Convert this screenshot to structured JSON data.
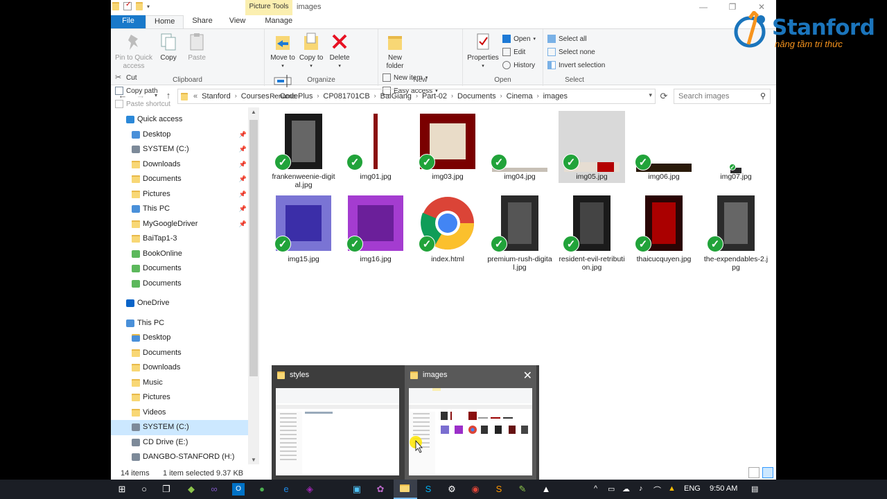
{
  "window": {
    "title": "images",
    "context_tab": "Picture Tools",
    "minimize": "—",
    "maximize": "❐",
    "close": "✕"
  },
  "tabs": [
    {
      "label": "File"
    },
    {
      "label": "Home"
    },
    {
      "label": "Share"
    },
    {
      "label": "View"
    },
    {
      "label": "Manage"
    }
  ],
  "ribbon": {
    "clipboard": {
      "label": "Clipboard",
      "pin": "Pin to Quick access",
      "copy": "Copy",
      "paste": "Paste",
      "cut": "Cut",
      "copy_path": "Copy path",
      "paste_shortcut": "Paste shortcut"
    },
    "organize": {
      "label": "Organize",
      "move_to": "Move to",
      "copy_to": "Copy to",
      "delete": "Delete",
      "rename": "Rename"
    },
    "new": {
      "label": "New",
      "new_folder": "New folder",
      "new_item": "New item",
      "easy_access": "Easy access"
    },
    "open": {
      "label": "Open",
      "properties": "Properties",
      "open": "Open",
      "edit": "Edit",
      "history": "History"
    },
    "select": {
      "label": "Select",
      "select_all": "Select all",
      "select_none": "Select none",
      "invert": "Invert selection"
    }
  },
  "address": {
    "segments": [
      "Stanford",
      "Courses",
      "CodePlus",
      "CP081701CB",
      "BaiGiang",
      "Part-02",
      "Documents",
      "Cinema",
      "images"
    ],
    "prefix": "«",
    "search_placeholder": "Search images"
  },
  "nav_pane": {
    "quick_access": "Quick access",
    "quick_items": [
      {
        "label": "Desktop",
        "pinned": true
      },
      {
        "label": "SYSTEM (C:)",
        "pinned": true
      },
      {
        "label": "Downloads",
        "pinned": true
      },
      {
        "label": "Documents",
        "pinned": true
      },
      {
        "label": "Pictures",
        "pinned": true
      },
      {
        "label": "This PC",
        "pinned": true
      },
      {
        "label": "MyGoogleDriver",
        "pinned": true
      },
      {
        "label": "BaiTap1-3",
        "pinned": false
      },
      {
        "label": "BookOnline",
        "pinned": false
      },
      {
        "label": "Documents",
        "pinned": false
      },
      {
        "label": "Documents",
        "pinned": false
      }
    ],
    "onedrive": "OneDrive",
    "this_pc": "This PC",
    "pc_items": [
      {
        "label": "Desktop"
      },
      {
        "label": "Documents"
      },
      {
        "label": "Downloads"
      },
      {
        "label": "Music"
      },
      {
        "label": "Pictures"
      },
      {
        "label": "Videos"
      },
      {
        "label": "SYSTEM (C:)"
      },
      {
        "label": "CD Drive (E:)"
      },
      {
        "label": "DANGBO-STANFORD (H:)"
      }
    ]
  },
  "files": [
    {
      "name": "frankenweenie-digital.jpg"
    },
    {
      "name": "img01.jpg"
    },
    {
      "name": "img03.jpg"
    },
    {
      "name": "img04.jpg"
    },
    {
      "name": "img05.jpg"
    },
    {
      "name": "img06.jpg"
    },
    {
      "name": "img07.jpg"
    },
    {
      "name": "img15.jpg"
    },
    {
      "name": "img16.jpg"
    },
    {
      "name": "index.html"
    },
    {
      "name": "premium-rush-digital.jpg"
    },
    {
      "name": "resident-evil-retribution.jpg"
    },
    {
      "name": "thaicucquyen.jpg"
    },
    {
      "name": "the-expendables-2.jpg"
    }
  ],
  "status": {
    "count": "14 items",
    "selected": "1 item selected",
    "size": "9.37 KB"
  },
  "switcher": {
    "windows": [
      {
        "title": "styles"
      },
      {
        "title": "images"
      }
    ],
    "close": "✕"
  },
  "taskbar": {
    "lang": "ENG",
    "time": "9:50 AM"
  },
  "logo": {
    "name": "Stanford",
    "tagline": "nâng tầm tri thức"
  },
  "colors": {
    "accent": "#1979ca",
    "check": "#21a33a",
    "selection": "#cce8ff"
  }
}
